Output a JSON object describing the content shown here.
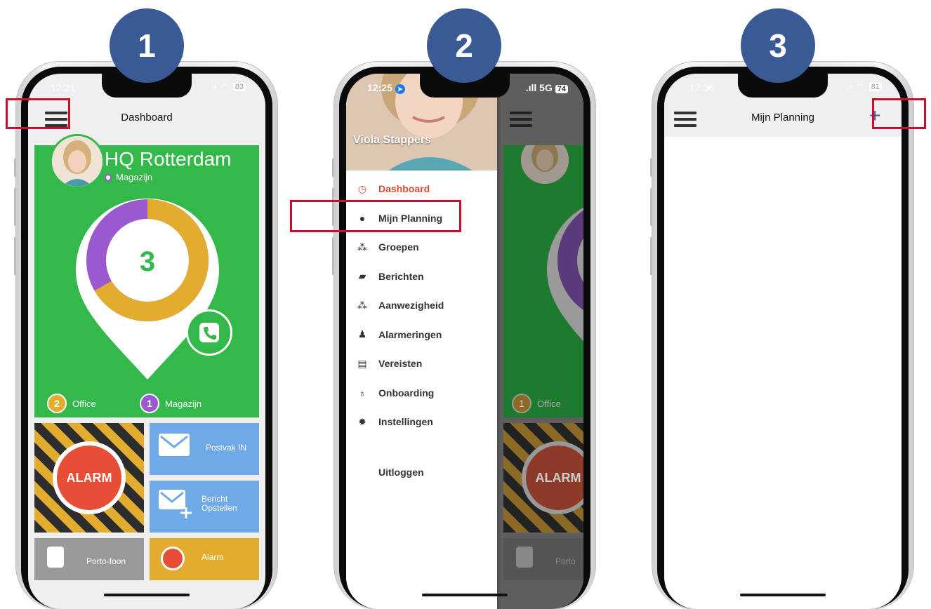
{
  "steps": [
    "1",
    "2",
    "3"
  ],
  "phone1": {
    "status": {
      "time": "12:21",
      "battery": "83"
    },
    "header_title": "Dashboard",
    "card": {
      "location": "HQ Rotterdam",
      "sublocation": "Magazijn",
      "total": "3",
      "legend": [
        {
          "count": "2",
          "label": "Office",
          "color": "#e2ad2e"
        },
        {
          "count": "1",
          "label": "Magazijn",
          "color": "#9b59d0"
        }
      ]
    },
    "tiles": {
      "alarm": "ALARM",
      "postvak": "Postvak IN",
      "bericht_line1": "Bericht",
      "bericht_line2": "Opstellen",
      "portofoon": "Porto-foon",
      "alarm_small": "Alarm"
    }
  },
  "phone2": {
    "status": {
      "time": "12:25",
      "signal": "5G",
      "battery": "74"
    },
    "profile_name": "Viola Stappers",
    "menu": [
      {
        "label": "Dashboard",
        "icon": "clock-icon",
        "active": true
      },
      {
        "label": "Mijn Planning",
        "icon": "person-icon",
        "active": false
      },
      {
        "label": "Groepen",
        "icon": "group-icon",
        "active": false
      },
      {
        "label": "Berichten",
        "icon": "chat-icon",
        "active": false
      },
      {
        "label": "Aanwezigheid",
        "icon": "group-icon",
        "active": false
      },
      {
        "label": "Alarmeringen",
        "icon": "bell-icon",
        "active": false
      },
      {
        "label": "Vereisten",
        "icon": "list-icon",
        "active": false
      },
      {
        "label": "Onboarding",
        "icon": "bulb-icon",
        "active": false
      },
      {
        "label": "Instellingen",
        "icon": "gear-icon",
        "active": false
      }
    ],
    "logout": "Uitloggen",
    "background": {
      "legend_count": "1",
      "legend_label": "Office",
      "alarm": "ALARM",
      "tile_text": "Porto"
    }
  },
  "phone3": {
    "status": {
      "time": "12:36",
      "battery": "81"
    },
    "header_title": "Mijn Planning",
    "add_glyph": "+"
  },
  "colors": {
    "green": "#33b94a",
    "orange": "#e2ad2e",
    "purple": "#9b59d0",
    "alarm_red": "#e84e36",
    "tile_blue": "#6fa9e8",
    "accent_red": "#e04a2f",
    "step_blue": "#3a5a96",
    "highlight_red": "#c8102e"
  }
}
